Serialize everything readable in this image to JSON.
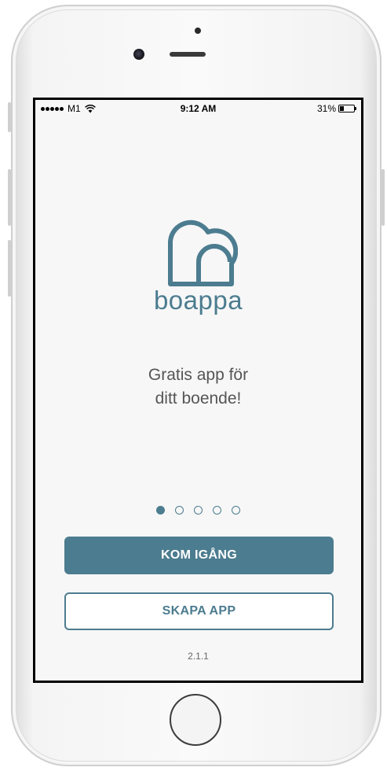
{
  "status_bar": {
    "carrier": "M1",
    "time": "9:12 AM",
    "battery_percent": "31%",
    "battery_level": 0.31,
    "signal_strength": 5
  },
  "brand": {
    "name": "boappa",
    "accent_color": "#4c7c8f",
    "logo_icon": "heart-house-logo-icon"
  },
  "onboarding": {
    "tagline_line1": "Gratis app för",
    "tagline_line2": "ditt boende!",
    "page_count": 5,
    "current_page": 1
  },
  "actions": {
    "primary_label": "KOM IGÅNG",
    "secondary_label": "SKAPA APP"
  },
  "footer": {
    "version": "2.1.1"
  }
}
